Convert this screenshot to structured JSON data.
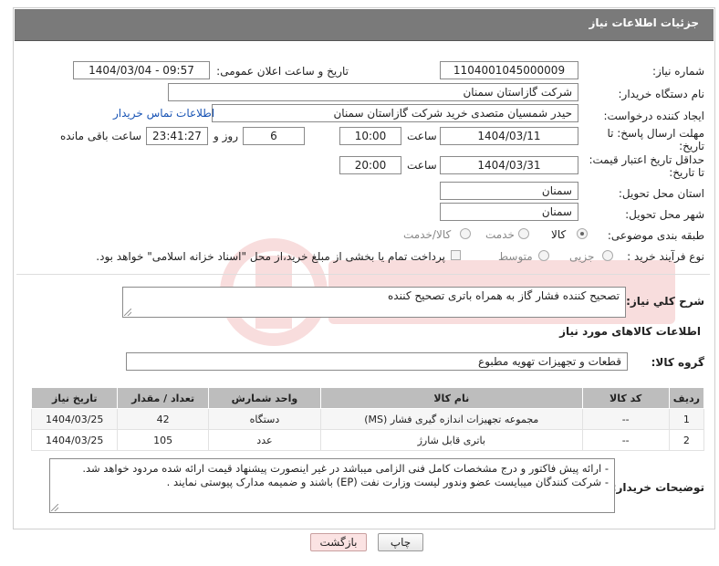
{
  "header": {
    "title": "جزئیات اطلاعات نیاز"
  },
  "form": {
    "need_number": {
      "label": "شماره نیاز:",
      "value": "1104001045000009"
    },
    "announce_datetime": {
      "label": "تاریخ و ساعت اعلان عمومی:",
      "value": "1404/03/04 - 09:57"
    },
    "buyer_org": {
      "label": "نام دستگاه خریدار:",
      "value": "شرکت گازاستان سمنان"
    },
    "requester": {
      "label": "ایجاد کننده درخواست:",
      "value": "حیدر شمسیان متصدی خرید شرکت گازاستان سمنان",
      "contact_link": "اطلاعات تماس خریدار"
    },
    "reply_deadline": {
      "label_line1": "مهلت ارسال پاسخ: تا",
      "label_line2": "تاریخ:",
      "date": "1404/03/11",
      "time_label": "ساعت",
      "time": "10:00",
      "days": "6",
      "days_label": "روز و",
      "remaining": "23:41:27",
      "remaining_label": "ساعت باقی مانده"
    },
    "price_validity": {
      "label_line1": "حداقل تاریخ اعتبار قیمت:",
      "label_line2": "تا تاریخ:",
      "date": "1404/03/31",
      "time_label": "ساعت",
      "time": "20:00"
    },
    "delivery_province": {
      "label": "استان محل تحویل:",
      "value": "سمنان"
    },
    "delivery_city": {
      "label": "شهر محل تحویل:",
      "value": "سمنان"
    },
    "category": {
      "label": "طبقه بندی موضوعی:",
      "options": [
        "کالا",
        "خدمت",
        "کالا/خدمت"
      ],
      "selected": "کالا"
    },
    "purchase_process": {
      "label": "نوع فرآیند خرید :",
      "options": [
        "جزیی",
        "متوسط"
      ],
      "selected": "",
      "treasury_note": "پرداخت تمام یا بخشی از مبلغ خرید،از محل \"اسناد خزانه اسلامی\" خواهد بود."
    }
  },
  "description": {
    "label": "شرح کلي نياز:",
    "value": "تصحیح کننده فشار گاز به همراه باتری تصحیح کننده"
  },
  "goods_section": {
    "title": "اطلاعات کالاهای مورد نیاز",
    "group_label": "گروه کالا:",
    "group_value": "قطعات و تجهیزات تهویه مطبوع"
  },
  "table": {
    "headers": [
      "ردیف",
      "کد کالا",
      "نام کالا",
      "واحد شمارش",
      "تعداد / مقدار",
      "تاریخ نیاز"
    ],
    "rows": [
      [
        "1",
        "--",
        "مجموعه تجهیزات اندازه گیری فشار (MS)",
        "دستگاه",
        "42",
        "1404/03/25"
      ],
      [
        "2",
        "--",
        "باتری قابل شارژ",
        "عدد",
        "105",
        "1404/03/25"
      ]
    ]
  },
  "buyer_notes": {
    "label": "توضیحات خریدار:",
    "line1": "- ارائه پیش فاکتور و درج مشخصات کامل فنی الزامی میباشد در غیر اینصورت پیشنهاد قیمت ارائه شده مردود خواهد شد.",
    "line2": "- شرکت کنندگان میبایست عضو وندور لیست وزارت نفت (EP) باشند و ضمیمه مدارک پیوستی نمایند ."
  },
  "buttons": {
    "print": "چاپ",
    "back": "بازگشت"
  },
  "colors": {
    "header_bg": "#7a7a7a",
    "table_header_bg": "#bdbdbd",
    "link": "#1a55b5",
    "back_button": "#fbe3e3"
  }
}
